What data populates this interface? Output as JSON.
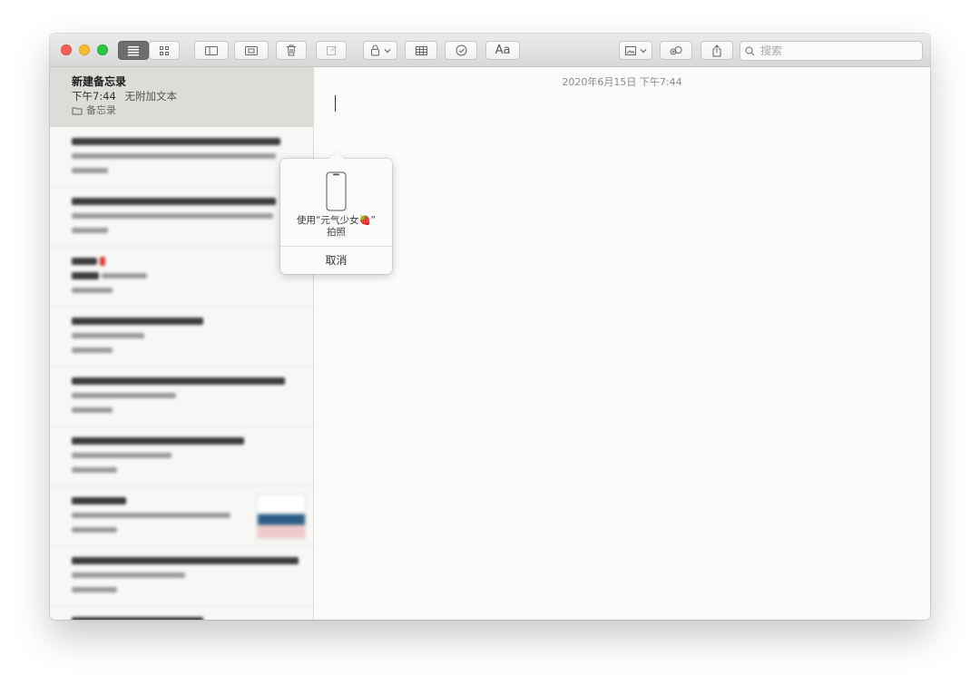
{
  "toolbar": {
    "format_label": "Aa",
    "search_placeholder": "搜索"
  },
  "sidebar": {
    "selected_note": {
      "title": "新建备忘录",
      "time": "下午7:44",
      "preview": "无附加文本",
      "folder": "备忘录"
    }
  },
  "editor": {
    "date": "2020年6月15日 下午7:44"
  },
  "popover": {
    "label_line1": "使用“元气少女🍓”",
    "label_line2": "拍照",
    "cancel": "取消"
  },
  "colors": {
    "close": "#fc5f58",
    "minimize": "#fdbc30",
    "zoom": "#28c840",
    "active_view": "#6e6e6e"
  }
}
